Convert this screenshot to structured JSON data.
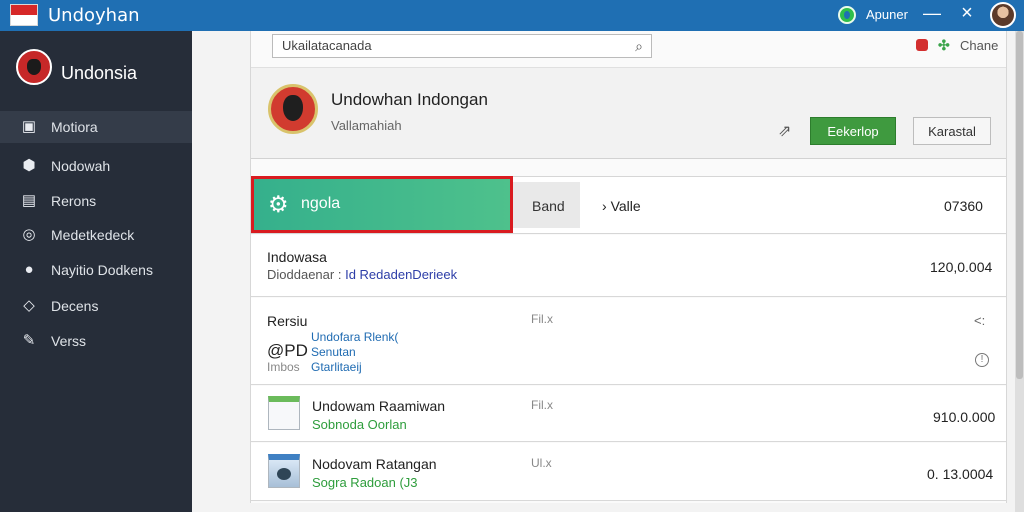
{
  "app": {
    "title": "Undoyhan",
    "window_label": "Apuner"
  },
  "sidebar": {
    "brand": "Undonsia",
    "items": [
      {
        "label": "Motiora",
        "icon": "play-square-icon"
      },
      {
        "label": "Nodowah",
        "icon": "location-pin-icon"
      },
      {
        "label": "Rerons",
        "icon": "grid-icon"
      },
      {
        "label": "Medetkedeck",
        "icon": "circle-ring-icon"
      },
      {
        "label": "Nayitio Dodkens",
        "icon": "person-icon"
      },
      {
        "label": "Decens",
        "icon": "tag-icon"
      },
      {
        "label": "Verss",
        "icon": "pencil-icon"
      }
    ]
  },
  "search": {
    "value": "Ukailatacanada"
  },
  "top_right": {
    "text": "Chane"
  },
  "profile": {
    "name": "Undowhan Indongan",
    "subtitle": "Vallamahiah"
  },
  "buttons": {
    "primary": "Eekerlop",
    "secondary": "Karastal"
  },
  "tabs": {
    "selected": "ngola",
    "band": "Band",
    "value_label": "Valle",
    "value_number": "07360"
  },
  "rows": [
    {
      "title": "Indowasa",
      "subtitle_prefix": "Dioddaenar :",
      "subtitle_link": "Id RedadenDerieek",
      "value": "120,0.004"
    },
    {
      "title": "Rersiu",
      "meta": "Fil.x",
      "lines": [
        "Undofara Rlenk(",
        "Senutan",
        "Gtarlitaeij"
      ],
      "code": "@PD",
      "small_label": "Imbos",
      "right_top": "<:"
    },
    {
      "title": "Undowam Raamiwan",
      "meta": "Fil.x",
      "subtitle": "Sobnoda Oorlan",
      "value": "910.0.000"
    },
    {
      "title": "Nodovam Ratangan",
      "meta": "Ul.x",
      "subtitle": "Sogra Radoan (J3",
      "value": "0. 13.0004"
    }
  ],
  "colors": {
    "titlebar": "#1f6fb3",
    "sidebar": "#262d39",
    "accent_green": "#3f9a3f",
    "selected_tab": "#35b08c",
    "selected_border": "#d91b20",
    "link": "#1f6bb2"
  }
}
